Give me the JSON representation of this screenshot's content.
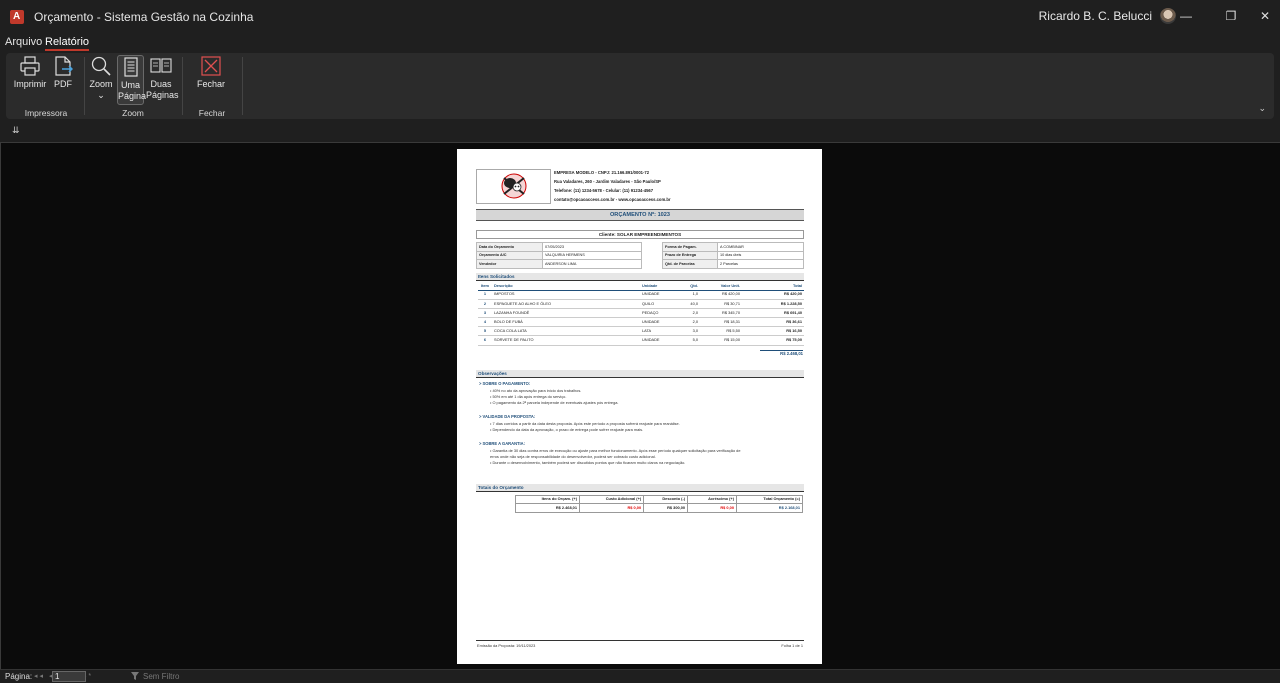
{
  "titlebar": {
    "app_icon_letter": "A",
    "title": "Orçamento  -  Sistema Gestão na Cozinha",
    "user_name": "Ricardo B. C. Belucci",
    "minimize": "—",
    "restore": "❐",
    "close": "✕"
  },
  "menu": {
    "items": [
      "Arquivo",
      "Relatório"
    ],
    "active": "Relatório"
  },
  "ribbon": {
    "buttons": {
      "imprimir": "Imprimir",
      "pdf": "PDF",
      "zoom": "Zoom",
      "uma_pagina_1": "Uma",
      "uma_pagina_2": "Página",
      "duas_paginas_1": "Duas",
      "duas_paginas_2": "Páginas",
      "fechar": "Fechar"
    },
    "groups": {
      "impressora": "Impressora",
      "zoom": "Zoom",
      "fechar_relatorio": "Fechar Relatório"
    },
    "zoom_caret": "⌄",
    "collapse_glyph": "⌄"
  },
  "qat": {
    "glyph": "⇊"
  },
  "report": {
    "company": {
      "line1": "EMPRESA MODELO - CNPJ: 21.166.891/0001-72",
      "line2": "Rua Valadares, 260 - Jardim Valadares - São Paulo/SP",
      "line3": "Telefone: (11) 1234-5678 - Celular: (11) 91234-4567",
      "line4": "contato@opcaoaccess.com.br - www.opcaoaccess.com.br"
    },
    "title": "ORÇAMENTO Nº: 1023",
    "client": "Cliente: SOLAR EMPREENDIMENTOS",
    "info_left": [
      {
        "label": "Data do Orçamento",
        "value": "07/05/2023"
      },
      {
        "label": "Orçamento A/C",
        "value": "VALQUIRIA HERMENS"
      },
      {
        "label": "Vendedor",
        "value": "ANDERSON LIMA"
      }
    ],
    "info_right": [
      {
        "label": "Forma de Pagam.",
        "value": "A COMBINAR"
      },
      {
        "label": "Prazo de Entrega",
        "value": "10 dias úteis"
      },
      {
        "label": "Qtd. de Parcelas",
        "value": "2 Parcelas"
      }
    ],
    "items_title": "Itens Solicitados",
    "items_headers": {
      "item": "Item",
      "descricao": "Descrição",
      "unidade": "Unidade",
      "qtd": "Qtd.",
      "valor": "Valor Unit.",
      "total": "Total"
    },
    "items": [
      {
        "n": "1",
        "desc": "IMPOSTOS",
        "un": "UNIDADE",
        "qtd": "1,0",
        "unit": "R$ 420,00",
        "total": "R$ 420,00"
      },
      {
        "n": "2",
        "desc": "ESPAGUETE AO ALHO E ÓLEO",
        "un": "QUILO",
        "qtd": "40,0",
        "unit": "R$ 30,71",
        "total": "R$ 1.228,50"
      },
      {
        "n": "3",
        "desc": "LAZANHA FOUNDÊ",
        "un": "PEDAÇO",
        "qtd": "2,0",
        "unit": "R$ 345,70",
        "total": "R$ 691,40"
      },
      {
        "n": "4",
        "desc": "BOLO DE FUBÁ",
        "un": "UNIDADE",
        "qtd": "2,0",
        "unit": "R$ 18,31",
        "total": "R$ 36,61"
      },
      {
        "n": "5",
        "desc": "COCA COLA LATA",
        "un": "LATA",
        "qtd": "3,0",
        "unit": "R$ 5,50",
        "total": "R$ 16,50"
      },
      {
        "n": "6",
        "desc": "SORVETE DE PALITO",
        "un": "UNIDADE",
        "qtd": "5,0",
        "unit": "R$ 15,00",
        "total": "R$ 75,00"
      }
    ],
    "items_grand_total": "R$ 2.468,01",
    "obs_title": "Observações",
    "obs": [
      {
        "head": "> SOBRE O PAGAMENTO:",
        "lines": [
          "• 40% no ato da aprovação para início dos trabalhos.",
          "• 50% em até 1 dia após entrega do serviço.",
          "• O pagamento da 2ª parcela independe de eventuais ajustes pós entrega."
        ]
      },
      {
        "head": "> VALIDADE DA PROPOSTA:",
        "lines": [
          "• 7 dias corridos a partir da data desta proposta. Após este período a proposta sofrerá reajuste para reanálise.",
          "• Dependendo da data da aprovação, o prazo de entrega pode sofrer reajuste para mais."
        ]
      },
      {
        "head": "> SOBRE A GARANTIA:",
        "lines": [
          "• Garantia de 30 dias contra erros de execução ou ajuste para melhor funcionamento. Após esse período qualquer solicitação para verificação de",
          "  erros onde não seja de responsabilidade do desenvolvedor, poderá ser cobrado custo adicional.",
          "• Durante o desenvolvimento, também poderá ser discutidos pontos que não ficaram muito claros na negociação."
        ]
      }
    ],
    "totals_title": "Totais do Orçamento",
    "totals_headers": [
      "Itens do Orçam. (+)",
      "Custo Adicional (+)",
      "Desconto (-)",
      "Acréscimo (+)",
      "Total Orçamento (=)"
    ],
    "totals_values": [
      "R$ 2.468,01",
      "R$ 0,00",
      "R$ 300,00",
      "R$ 0,00",
      "R$ 2.168,01"
    ],
    "footer_left": "Emissão da Proposta: 19/11/2023",
    "footer_right": "Folha 1 de 1"
  },
  "status": {
    "pagina_label": "Página:",
    "page_value": "1",
    "filter": "Sem Filtro",
    "nav": "◂◂ ◂ ▸ ▸▸ ▸*"
  }
}
